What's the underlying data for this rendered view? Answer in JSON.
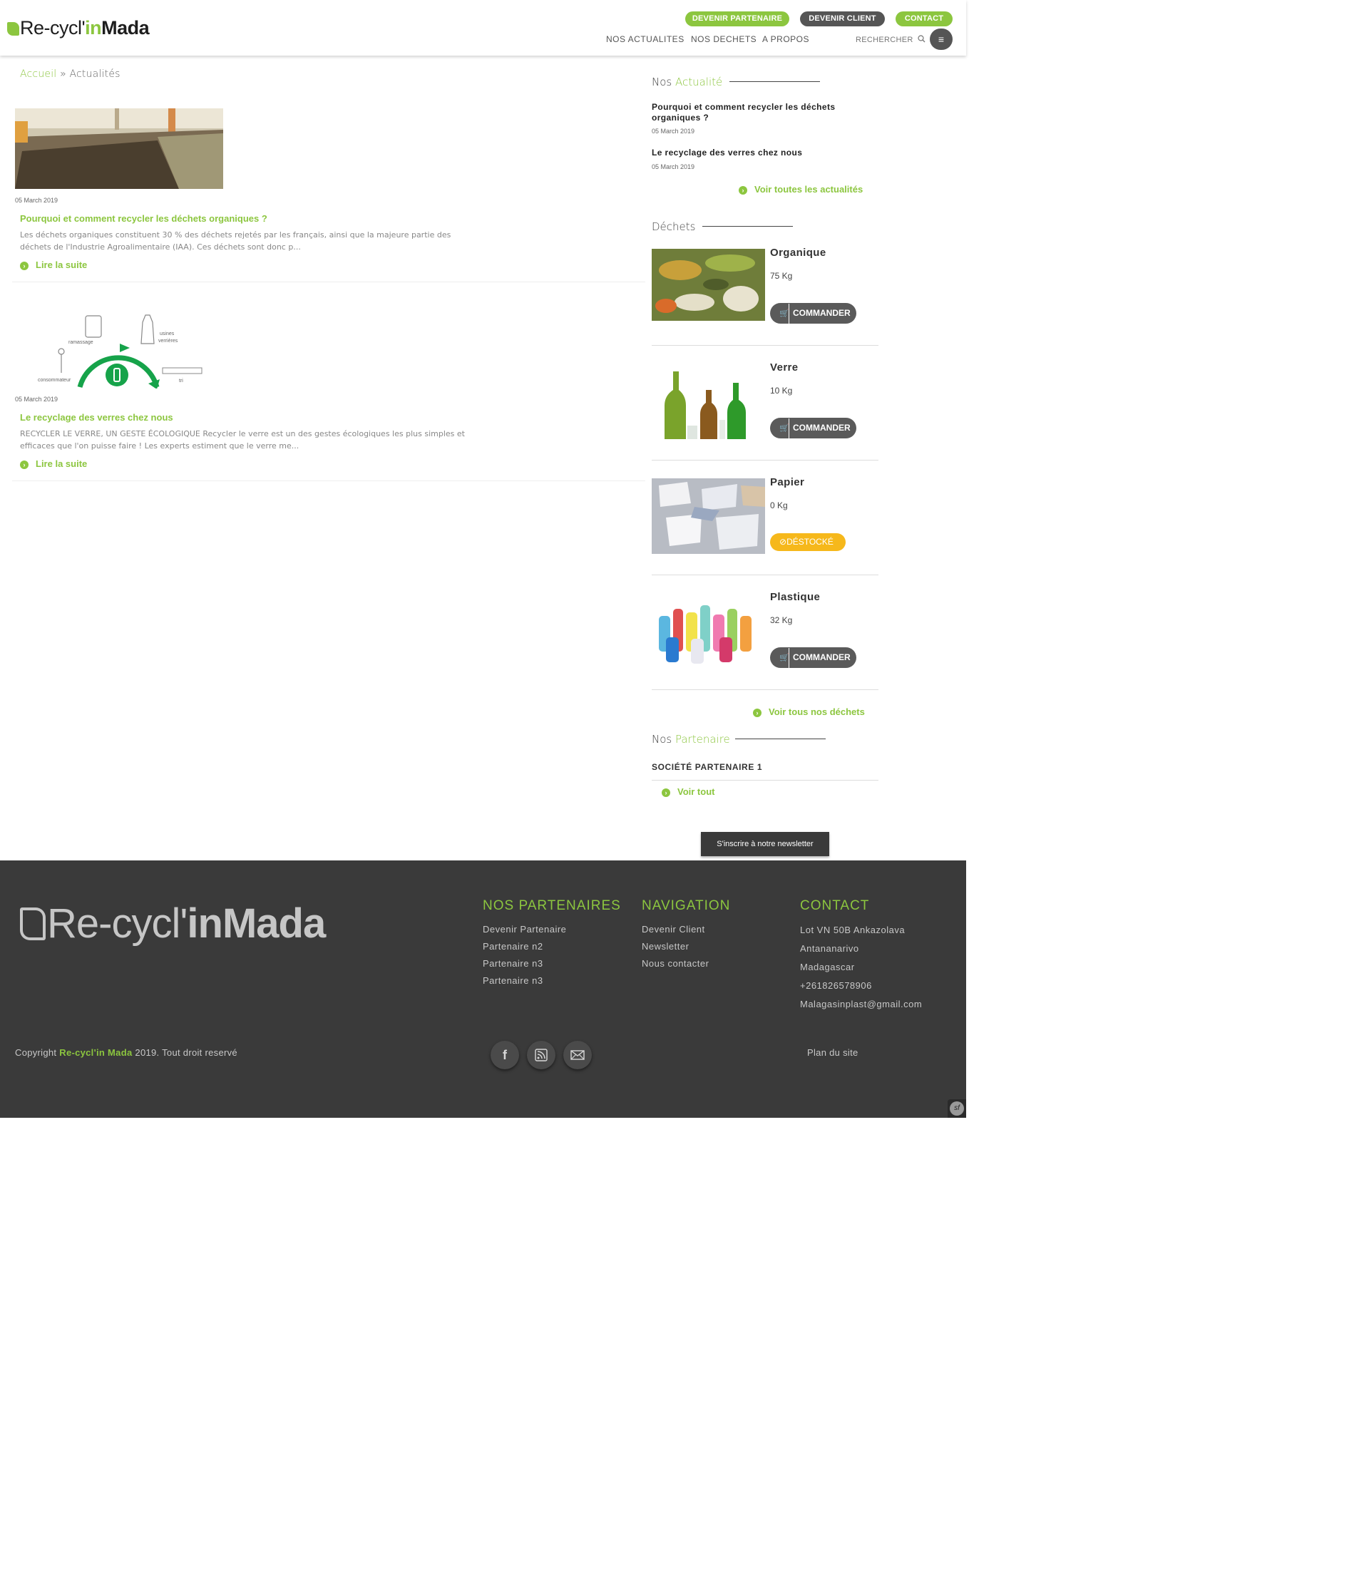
{
  "header": {
    "logo": {
      "part1": "Re-cycl'",
      "part2": "in",
      "part3": "Mada"
    },
    "buttons": {
      "partner": "DEVENIR PARTENAIRE",
      "client": "DEVENIR CLIENT",
      "contact": "CONTACT"
    },
    "nav": [
      "NOS ACTUALITES",
      "NOS DECHETS",
      "A PROPOS"
    ],
    "search_label": "RECHERCHER"
  },
  "breadcrumb": {
    "home": "Accueil",
    "separator": "»",
    "current": "Actualités"
  },
  "articles": [
    {
      "date": "05 March 2019",
      "title": "Pourquoi et comment recycler les déchets organiques ?",
      "excerpt": "Les déchets organiques constituent 30 % des déchets rejetés par les français, ainsi que la majeure partie des déchets de l'Industrie Agroalimentaire  (IAA). Ces déchets sont donc p...",
      "read_more": "Lire la suite"
    },
    {
      "date": "05 March 2019",
      "title": "Le recyclage des verres chez nous",
      "excerpt": "RECYCLER LE VERRE, UN GESTE ÉCOLOGIQUE Recycler le verre est un des gestes écologiques les plus simples et efficaces que l'on puisse faire ! Les experts estiment que le verre me...",
      "read_more": "Lire la suite",
      "diagram_labels": {
        "ramassage": "ramassage",
        "usines": "usines",
        "verrieres": "verrières",
        "consommateur": "consommateur",
        "tri": "tri"
      }
    }
  ],
  "sidebar": {
    "news_heading": {
      "prefix": "Nos ",
      "accent": "Actualité"
    },
    "news": [
      {
        "title": "Pourquoi et comment recycler les déchets organiques ?",
        "date": "05 March 2019"
      },
      {
        "title": "Le recyclage des verres chez nous",
        "date": "05 March 2019"
      }
    ],
    "news_link": "Voir toutes les actualités",
    "waste_heading": "Déchets",
    "waste": [
      {
        "name": "Organique",
        "qty": "75 Kg",
        "action": "COMMANDER"
      },
      {
        "name": "Verre",
        "qty": "10 Kg",
        "action": "COMMANDER"
      },
      {
        "name": "Papier",
        "qty": "0 Kg",
        "action": "DÉSTOCKÉ"
      },
      {
        "name": "Plastique",
        "qty": "32 Kg",
        "action": "COMMANDER"
      }
    ],
    "waste_link": "Voir tous nos déchets",
    "partner_heading": {
      "prefix": "Nos ",
      "accent": "Partenaire"
    },
    "partner_name": "SOCIÉTÉ PARTENAIRE 1",
    "partner_link": "Voir tout",
    "newsletter_button": "S'inscrire à notre newsletter"
  },
  "footer": {
    "logo": {
      "part1": "Re-cycl'",
      "part2": "inMada"
    },
    "partners": {
      "heading": "NOS PARTENAIRES",
      "links": [
        "Devenir Partenaire",
        "Partenaire n2",
        "Partenaire n3",
        "Partenaire n3"
      ]
    },
    "navigation": {
      "heading": "NAVIGATION",
      "links": [
        "Devenir Client",
        "Newsletter",
        "Nous contacter"
      ]
    },
    "contact": {
      "heading": "CONTACT",
      "lines": [
        "Lot VN 50B Ankazolava",
        "Antananarivo",
        "Madagascar",
        "+261826578906",
        "Malagasinplast@gmail.com"
      ]
    },
    "copyright": {
      "prefix": "Copyright ",
      "brand": "Re-cycl'in Mada",
      "suffix": " 2019. Tout droit reservé"
    },
    "sitemap": "Plan du site"
  },
  "colors": {
    "accent": "#8cc63f",
    "dark": "#555555",
    "warning": "#f6b81b",
    "footer_bg": "#3a3a3a"
  },
  "icons": [
    "leaf-logo-icon",
    "search-icon",
    "hamburger-icon",
    "circle-arrow-right-icon",
    "cart-icon",
    "ban-icon",
    "facebook-icon",
    "rss-icon",
    "mail-icon",
    "symfony-icon"
  ]
}
